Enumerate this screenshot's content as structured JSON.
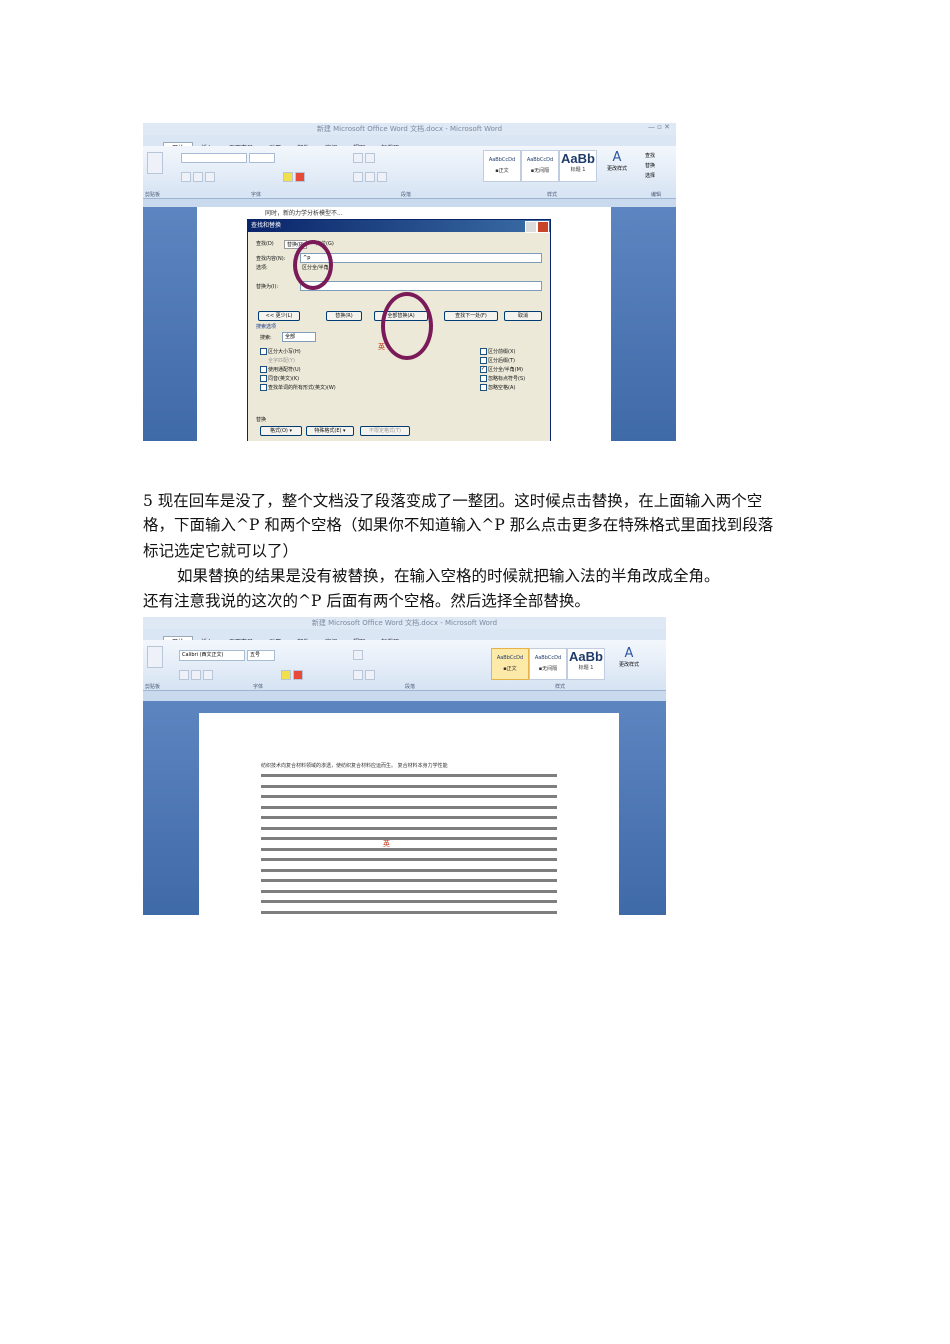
{
  "shot1": {
    "window_title": "新建 Microsoft Office Word 文档.docx - Microsoft Word",
    "tabs": [
      "开始",
      "插入",
      "页面布局",
      "引用",
      "邮件",
      "审阅",
      "视图",
      "加载项"
    ],
    "groups": [
      "剪贴板",
      "字体",
      "段落",
      "样式",
      "编辑"
    ],
    "styles": [
      "AaBbCcDd",
      "AaBbCcDd",
      "AaBb"
    ],
    "style_labels": [
      "▪正文",
      "▪无间隔",
      "标题 1"
    ],
    "change_styles": "更改样式",
    "edit_items": [
      "查找",
      "替换",
      "选择"
    ],
    "doc_line": "同时，新的力学分析模型不...",
    "dialog": {
      "title": "查找和替换",
      "tabs": [
        "查找(D)",
        "替换(P)",
        "定位(G)"
      ],
      "find_label": "查找内容(N):",
      "find_value": "^p",
      "options_label": "选项:",
      "options_value": "区分全/半角",
      "replace_label": "替换为(I):",
      "buttons": [
        "<< 更少(L)",
        "替换(R)",
        "全部替换(A)",
        "查找下一处(F)",
        "取消"
      ],
      "search_options": "搜索选项",
      "search_label": "搜索:",
      "search_value": "全部",
      "left_options": [
        "区分大小写(H)",
        "全字匹配(Y)",
        "使用通配符(U)",
        "同音(英文)(K)",
        "查找单词的所有形式(英文)(W)"
      ],
      "right_options": [
        "区分前缀(X)",
        "区分后缀(T)",
        "区分全/半角(M)",
        "忽略标点符号(S)",
        "忽略空格(A)"
      ],
      "ime": "英",
      "replace_section": "替换",
      "bottom_buttons": [
        "格式(O) ▾",
        "特殊格式(E) ▾",
        "不限定格式(T)"
      ]
    }
  },
  "text": {
    "line1": "5 现在回车是没了，整个文档没了段落变成了一整团。这时候点击替换，在上面输入两个空",
    "line2": "格，下面输入^P 和两个空格（如果你不知道输入^P 那么点击更多在特殊格式里面找到段落",
    "line3": "标记选定它就可以了）",
    "line4": "如果替换的结果是没有被替换，在输入空格的时候就把输入法的半角改成全角。",
    "line5": "还有注意我说的这次的^P 后面有两个空格。然后选择全部替换。"
  },
  "shot2": {
    "window_title": "新建 Microsoft Office Word 文档.docx - Microsoft Word",
    "tabs": [
      "开始",
      "插入",
      "页面布局",
      "引用",
      "邮件",
      "审阅",
      "视图",
      "加载项"
    ],
    "font_name": "Calibri (西文正文)",
    "font_size": "五号",
    "groups": [
      "剪贴板",
      "字体",
      "段落",
      "样式"
    ],
    "styles": [
      "AaBbCcDd",
      "AaBbCcDd",
      "AaBb"
    ],
    "style_labels": [
      "▪正文",
      "▪无间隔",
      "标题 1"
    ],
    "change_styles": "更改样式",
    "ime": "英",
    "doc_first_line": "纺织技术向复合材料领域的渗透，使纺织复合材料应运而生。 复合材料本身力学性能"
  }
}
